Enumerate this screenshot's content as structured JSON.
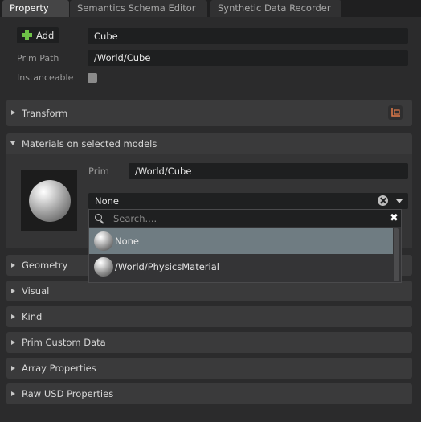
{
  "tabs": [
    {
      "label": "Property"
    },
    {
      "label": "Semantics Schema Editor"
    },
    {
      "label": "Synthetic Data Recorder"
    }
  ],
  "top": {
    "add_label": "Add",
    "name_value": "Cube",
    "prim_path_label": "Prim Path",
    "prim_path_value": "/World/Cube",
    "instanceable_label": "Instanceable"
  },
  "sections": {
    "transform": "Transform",
    "materials": "Materials on selected models",
    "geometry": "Geometry",
    "visual": "Visual",
    "kind": "Kind",
    "prim_custom_data": "Prim Custom Data",
    "array_properties": "Array Properties",
    "raw_usd_properties": "Raw USD Properties"
  },
  "materials": {
    "prim_label": "Prim",
    "prim_value": "/World/Cube",
    "combo_value": "None"
  },
  "dropdown": {
    "search_placeholder": "Search....",
    "items": [
      {
        "label": "None",
        "selected": true
      },
      {
        "label": "/World/PhysicsMaterial",
        "selected": false
      }
    ]
  },
  "colors": {
    "accent_green": "#6ec247",
    "selection": "#6f7c82",
    "background": "#2b2b2c"
  }
}
